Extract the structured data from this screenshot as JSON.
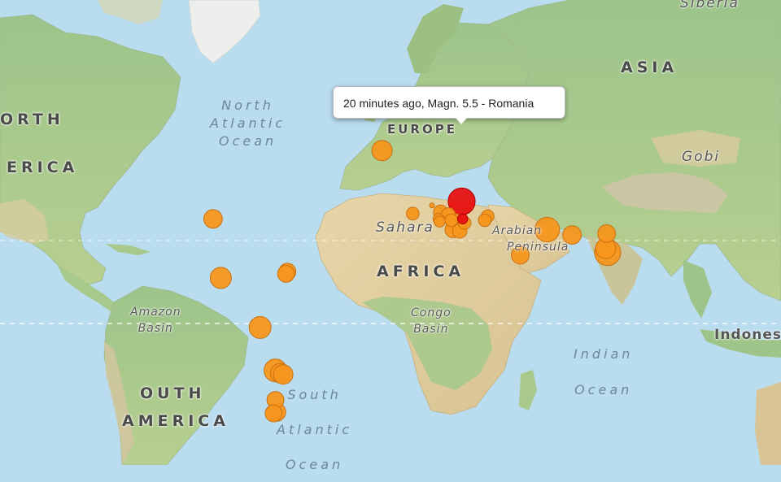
{
  "tooltip": {
    "text": "20 minutes ago, Magn. 5.5 - Romania"
  },
  "labels": {
    "siberia": "Siberia",
    "asia": "ASIA",
    "europe": "EUROPE",
    "north_america_1": "ORTH",
    "north_america_2": "ERICA",
    "north_atlantic": [
      "North",
      "Atlantic",
      "Ocean"
    ],
    "gobi": "Gobi",
    "sahara": "Sahara",
    "arabia": [
      "Arabian",
      "Peninsula"
    ],
    "africa": "AFRICA",
    "amazon": [
      "Amazon",
      "Basin"
    ],
    "congo": [
      "Congo",
      "Basin"
    ],
    "indian_ocean": [
      "Indian",
      "Ocean"
    ],
    "indonesia": "Indones",
    "south_america_1": "OUTH",
    "south_america_2": "AMERICA",
    "south_atlantic": [
      "South",
      "Atlantic",
      "Ocean"
    ]
  },
  "colors": {
    "water": "#b9dcef",
    "land": "#d9cfa4",
    "vegetation": "#9fc48a",
    "ice": "#f2f2f0",
    "quake_marker": "#f5961e",
    "quake_border": "#c9700f",
    "recent_marker": "#e81010"
  },
  "earthquakes": [
    {
      "lat": 64.5,
      "lon": -15.0,
      "mag": 4.7
    },
    {
      "lat": 39.0,
      "lon": -103.0,
      "mag": 4.5
    },
    {
      "lat": 17.0,
      "lon": -99.0,
      "mag": 4.8
    },
    {
      "lat": 19.3,
      "lon": -64.3,
      "mag": 4.3
    },
    {
      "lat": 18.5,
      "lon": -65.0,
      "mag": 4.3
    },
    {
      "lat": -1.5,
      "lon": -78.5,
      "mag": 4.9
    },
    {
      "lat": -17.5,
      "lon": -70.5,
      "mag": 5.0
    },
    {
      "lat": -18.5,
      "lon": -68.0,
      "mag": 4.6
    },
    {
      "lat": -19.0,
      "lon": -66.5,
      "mag": 4.6
    },
    {
      "lat": -28.5,
      "lon": -70.5,
      "mag": 4.3
    },
    {
      "lat": -33.0,
      "lon": -70.0,
      "mag": 4.5
    },
    {
      "lat": -33.5,
      "lon": -71.5,
      "mag": 4.3
    },
    {
      "lat": 45.5,
      "lon": 26.5,
      "mag": 5.5,
      "recent": true
    },
    {
      "lat": 39.0,
      "lon": 27.0,
      "mag": 3.5,
      "recent": true
    },
    {
      "lat": 44.0,
      "lon": 11.0,
      "mag": 2.8
    },
    {
      "lat": 41.0,
      "lon": 1.0,
      "mag": 3.8
    },
    {
      "lat": 41.5,
      "lon": 15.5,
      "mag": 4.0
    },
    {
      "lat": 39.0,
      "lon": 14.5,
      "mag": 3.6
    },
    {
      "lat": 38.0,
      "lon": 15.0,
      "mag": 3.6
    },
    {
      "lat": 40.5,
      "lon": 19.5,
      "mag": 4.0
    },
    {
      "lat": 38.5,
      "lon": 21.0,
      "mag": 3.8
    },
    {
      "lat": 38.0,
      "lon": 23.0,
      "mag": 4.2
    },
    {
      "lat": 35.0,
      "lon": 22.0,
      "mag": 4.2
    },
    {
      "lat": 36.5,
      "lon": 24.5,
      "mag": 4.4
    },
    {
      "lat": 34.5,
      "lon": 25.5,
      "mag": 4.0
    },
    {
      "lat": 37.5,
      "lon": 28.0,
      "mag": 3.8
    },
    {
      "lat": 40.0,
      "lon": 40.0,
      "mag": 3.8
    },
    {
      "lat": 38.5,
      "lon": 38.5,
      "mag": 3.8
    },
    {
      "lat": 25.5,
      "lon": 57.0,
      "mag": 4.4
    },
    {
      "lat": 35.0,
      "lon": 71.0,
      "mag": 5.2
    },
    {
      "lat": 33.0,
      "lon": 84.0,
      "mag": 4.5
    },
    {
      "lat": 33.5,
      "lon": 102.0,
      "mag": 4.4
    },
    {
      "lat": 28.0,
      "lon": 101.5,
      "mag": 4.7
    },
    {
      "lat": 26.5,
      "lon": 102.5,
      "mag": 5.4
    }
  ]
}
